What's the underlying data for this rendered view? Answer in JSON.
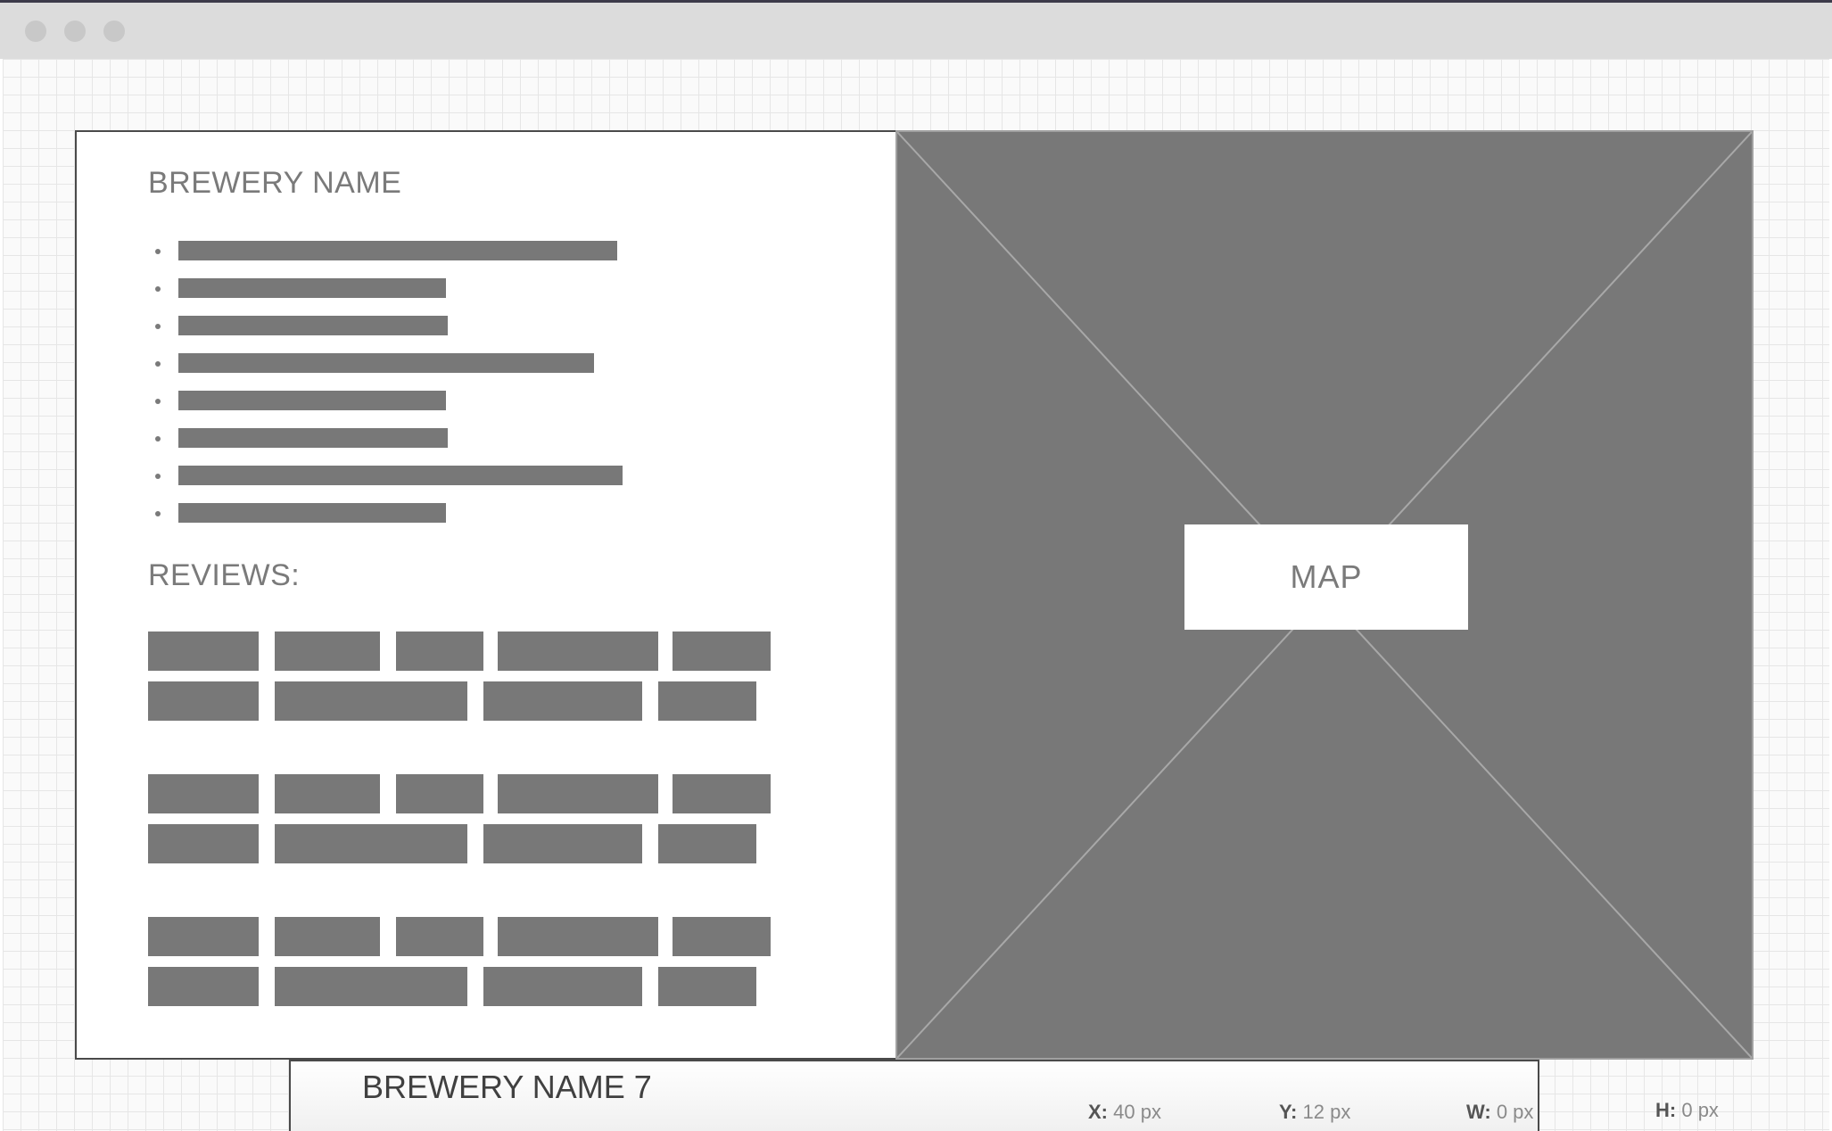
{
  "window": {
    "controls": [
      "close",
      "minimize",
      "zoom"
    ]
  },
  "detail_panel": {
    "title": "BREWERY NAME",
    "detail_list_placeholders": [
      {
        "width_fraction": 0.76
      },
      {
        "width_fraction": 0.46
      },
      {
        "width_fraction": 0.46
      },
      {
        "width_fraction": 0.72
      },
      {
        "width_fraction": 0.46
      },
      {
        "width_fraction": 0.46
      },
      {
        "width_fraction": 0.77
      },
      {
        "width_fraction": 0.46
      }
    ],
    "reviews_heading": "REVIEWS:",
    "review_placeholder_count": 3
  },
  "map": {
    "label": "MAP"
  },
  "status_bar": {
    "selected_element": "BREWERY NAME 7",
    "x_label": "X:",
    "x_value": "40 px",
    "y_label": "Y:",
    "y_value": "12 px",
    "w_label": "W:",
    "w_value": "0 px",
    "h_label": "H:",
    "h_value": "0 px"
  },
  "colors": {
    "placeholder": "#787878",
    "panel_border": "#4a4a4a",
    "titlebar": "#dcdcdc",
    "heading_text": "#7a7a7a"
  }
}
